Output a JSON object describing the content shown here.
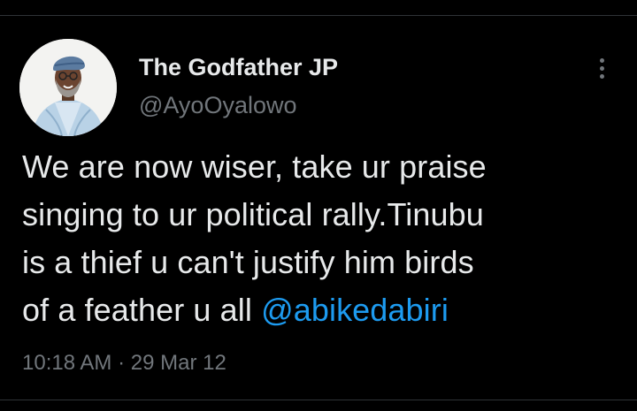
{
  "tweet": {
    "author": {
      "display_name": "The Godfather JP",
      "handle": "@AyoOyalowo"
    },
    "text_lines": [
      "We are now wiser, take ur praise",
      "singing to ur political rally.Tinubu",
      "is a thief u can't justify him  birds",
      "of a feather u all "
    ],
    "mention": "@abikedabiri",
    "time": "10:18 AM",
    "separator": "·",
    "date": "29 Mar 12"
  },
  "icons": {
    "more": "more-vertical-icon"
  },
  "colors": {
    "background": "#000000",
    "primary_text": "#e7e9ea",
    "secondary_text": "#71767b",
    "link": "#1d9bf0",
    "divider": "#2f3336"
  }
}
